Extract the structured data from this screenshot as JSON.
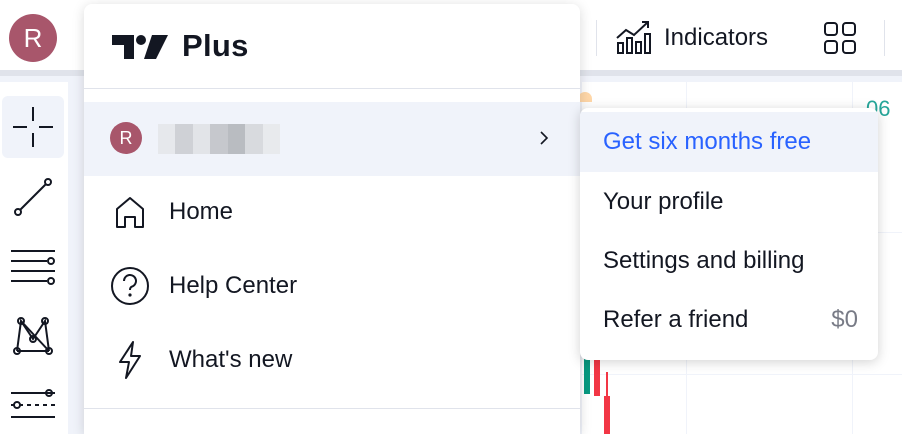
{
  "topbar": {
    "avatar_letter": "R",
    "indicators_label": "Indicators",
    "price_text": "06"
  },
  "menu": {
    "brand": "Plus",
    "user": {
      "avatar_letter": "R"
    },
    "items": [
      {
        "label": "Home",
        "icon": "home-icon"
      },
      {
        "label": "Help Center",
        "icon": "help-circle-icon"
      },
      {
        "label": "What's new",
        "icon": "lightning-icon"
      }
    ]
  },
  "submenu": {
    "items": [
      {
        "label": "Get six months free",
        "highlight": true
      },
      {
        "label": "Your profile"
      },
      {
        "label": "Settings and billing"
      },
      {
        "label": "Refer a friend",
        "value": "$0"
      }
    ]
  },
  "tools": [
    "crosshair-icon",
    "trend-line-icon",
    "fib-lines-icon",
    "pattern-icon",
    "projection-icon"
  ],
  "colors": {
    "accent_blue": "#2962ff",
    "avatar": "#a8566b",
    "price_green": "#26a69a",
    "candle_red": "#f23645",
    "candle_green": "#089981"
  }
}
